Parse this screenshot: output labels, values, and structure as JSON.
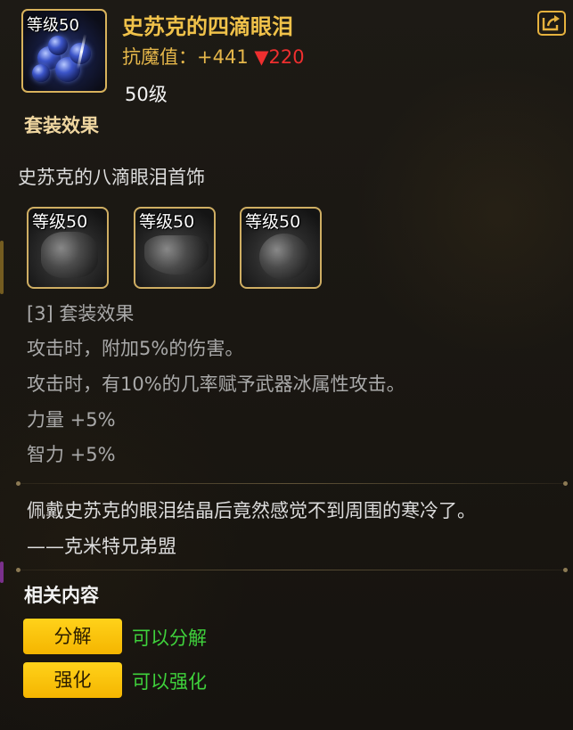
{
  "item": {
    "level_tag": "等级50",
    "title": "史苏克的四滴眼泪",
    "stat_label": "抗魔值：",
    "stat_value": "+441",
    "stat_delta_arrow": "▼",
    "stat_delta": "220",
    "required_level": "50级"
  },
  "share_icon": "share-arrow-icon",
  "set_section": {
    "title": "套装效果",
    "set_name": "史苏克的八滴眼泪首饰",
    "pieces": [
      {
        "level_tag": "等级50",
        "icon": "bracelet-icon"
      },
      {
        "level_tag": "等级50",
        "icon": "necklace-icon"
      },
      {
        "level_tag": "等级50",
        "icon": "ring-icon"
      }
    ],
    "effects": [
      "[3] 套装效果",
      "攻击时，附加5%的伤害。",
      "攻击时，有10%的几率赋予武器冰属性攻击。",
      "力量 +5%",
      "智力 +5%"
    ]
  },
  "flavor": {
    "text": "佩戴史苏克的眼泪结晶后竟然感觉不到周围的寒冷了。",
    "author": "——克米特兄弟盟"
  },
  "related": {
    "title": "相关内容",
    "actions": [
      {
        "button": "分解",
        "note": "可以分解"
      },
      {
        "button": "强化",
        "note": "可以强化"
      }
    ]
  },
  "colors": {
    "title_gold": "#f0c24a",
    "stat_gold": "#e5b74a",
    "decrease_red": "#ee2f2f",
    "positive_green": "#3fd23c",
    "button_yellow": "#ffd21a",
    "frame_gold": "#d8b25c"
  }
}
